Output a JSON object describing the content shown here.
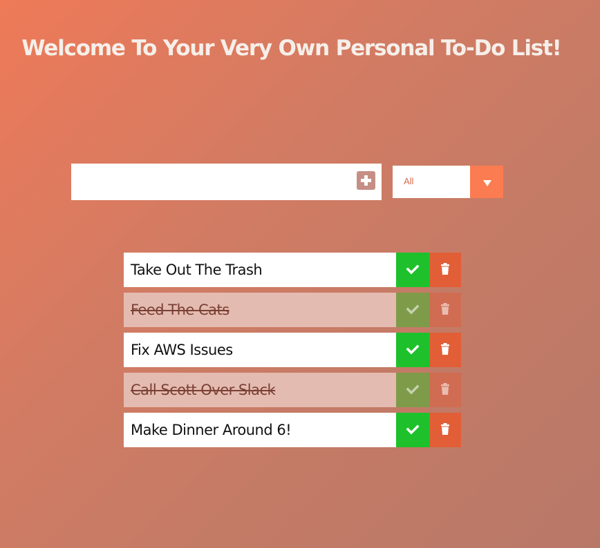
{
  "header": {
    "title": "Welcome To Your Very Own Personal To-Do List!"
  },
  "add_bar": {
    "input_value": "",
    "placeholder": "",
    "add_icon": "plus-square-icon"
  },
  "filter": {
    "selected": "All",
    "arrow_icon": "caret-down-icon"
  },
  "todos": [
    {
      "text": "Take Out The Trash",
      "completed": false
    },
    {
      "text": "Feed The Cats",
      "completed": true
    },
    {
      "text": "Fix AWS Issues",
      "completed": false
    },
    {
      "text": "Call Scott Over Slack",
      "completed": true
    },
    {
      "text": "Make Dinner Around 6!",
      "completed": false
    }
  ],
  "icons": {
    "complete": "check-icon",
    "delete": "trash-icon"
  },
  "colors": {
    "background_start": "#ee7a58",
    "background_end": "#b87868",
    "complete_button": "#1ec12b",
    "delete_button": "#e15e36",
    "filter_arrow": "#fb7c51",
    "completed_item_bg": "#e4bbb0"
  }
}
